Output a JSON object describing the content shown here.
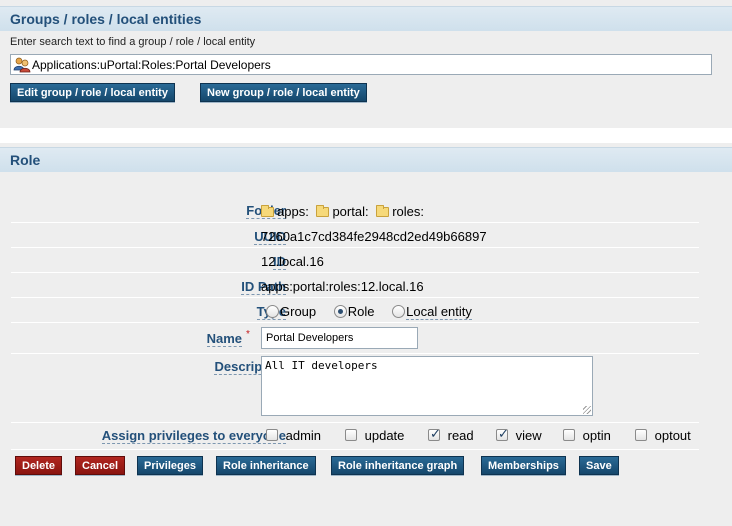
{
  "groups_section": {
    "title": "Groups / roles / local entities",
    "search_hint": "Enter search text to find a group / role / local entity",
    "search_value": "Applications:uPortal:Roles:Portal Developers",
    "edit_button": "Edit group / role / local entity",
    "new_button": "New group / role / local entity"
  },
  "role_section": {
    "title": "Role",
    "folder": {
      "label": "Folder",
      "parts": [
        "apps:",
        "portal:",
        "roles:"
      ]
    },
    "uuid": {
      "label": "UUID",
      "value": "7260a1c7cd384fe2948cd2ed49b66897"
    },
    "id": {
      "label": "ID",
      "value": "12.local.16"
    },
    "id_path": {
      "label": "ID Path",
      "value": "apps:portal:roles:12.local.16"
    },
    "type": {
      "label": "Type",
      "options": [
        "Group",
        "Role",
        "Local entity"
      ],
      "selected": "Role"
    },
    "name": {
      "label": "Name",
      "required_mark": "*",
      "value": "Portal Developers"
    },
    "description": {
      "label": "Description",
      "value": "All IT developers"
    },
    "privileges": {
      "label": "Assign privileges to everyone",
      "options": [
        {
          "label": "admin",
          "checked": false
        },
        {
          "label": "update",
          "checked": false
        },
        {
          "label": "read",
          "checked": true
        },
        {
          "label": "view",
          "checked": true
        },
        {
          "label": "optin",
          "checked": false
        },
        {
          "label": "optout",
          "checked": false
        }
      ]
    },
    "buttons": {
      "delete": "Delete",
      "cancel": "Cancel",
      "privileges": "Privileges",
      "role_inheritance": "Role inheritance",
      "role_inheritance_graph": "Role inheritance graph",
      "memberships": "Memberships",
      "save": "Save"
    }
  },
  "colors": {
    "header_text": "#23507a",
    "button_blue": "#1b557f",
    "button_red": "#9b1c16",
    "panel_bg": "#eeeeee"
  }
}
